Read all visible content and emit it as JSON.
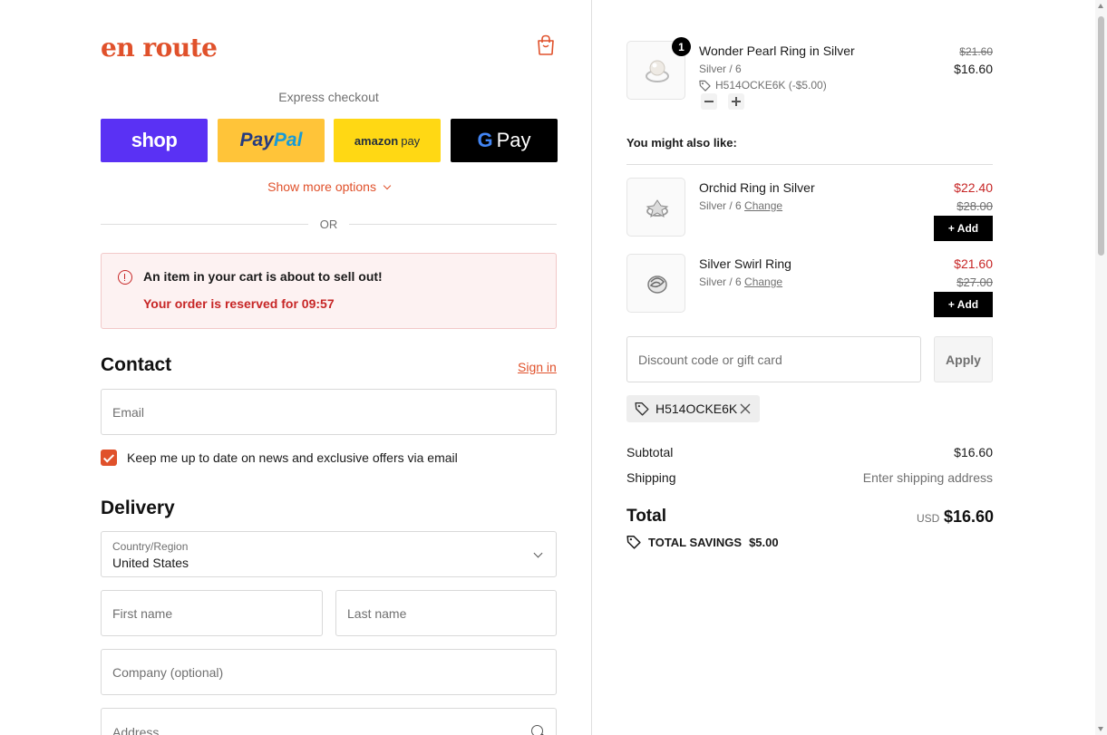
{
  "brand": {
    "name": "en route",
    "accent": "#e0512b"
  },
  "express": {
    "label": "Express checkout",
    "shop": "shop",
    "paypal_a": "Pay",
    "paypal_b": "Pal",
    "amazon_a": "amazon",
    "amazon_b": "pay",
    "gpay_g": "G",
    "gpay_text": "Pay",
    "show_more": "Show more options",
    "or": "OR"
  },
  "alert": {
    "title": "An item in your cart is about to sell out!",
    "subtitle": "Your order is reserved for 09:57"
  },
  "contact": {
    "heading": "Contact",
    "sign_in": "Sign in",
    "email_placeholder": "Email",
    "newsletter_label": "Keep me up to date on news and exclusive offers via email",
    "newsletter_checked": true
  },
  "delivery": {
    "heading": "Delivery",
    "country_label": "Country/Region",
    "country_value": "United States",
    "first_name_placeholder": "First name",
    "last_name_placeholder": "Last name",
    "company_placeholder": "Company (optional)",
    "address_placeholder": "Address"
  },
  "cart": {
    "items": [
      {
        "quantity": "1",
        "title": "Wonder Pearl Ring in Silver",
        "variant": "Silver / 6",
        "discount": "H514OCKE6K (-$5.00)",
        "old_price": "$21.60",
        "price": "$16.60"
      }
    ]
  },
  "upsell": {
    "heading": "You might also like:",
    "change_label": "Change",
    "add_label": "+ Add",
    "items": [
      {
        "title": "Orchid Ring in Silver",
        "variant": "Silver / 6",
        "price": "$22.40",
        "old_price": "$28.00"
      },
      {
        "title": "Silver Swirl Ring",
        "variant": "Silver / 6",
        "price": "$21.60",
        "old_price": "$27.00"
      }
    ]
  },
  "discount": {
    "placeholder": "Discount code or gift card",
    "apply_label": "Apply",
    "applied_code": "H514OCKE6K"
  },
  "summary": {
    "subtotal_label": "Subtotal",
    "subtotal_value": "$16.60",
    "shipping_label": "Shipping",
    "shipping_value": "Enter shipping address",
    "total_label": "Total",
    "currency": "USD",
    "total_value": "$16.60",
    "savings_label": "TOTAL SAVINGS",
    "savings_value": "$5.00"
  },
  "colors": {
    "sale_red": "#c72626",
    "shop_purple": "#5a31f4",
    "paypal_yellow": "#ffc439",
    "amazon_yellow": "#ffd814"
  }
}
